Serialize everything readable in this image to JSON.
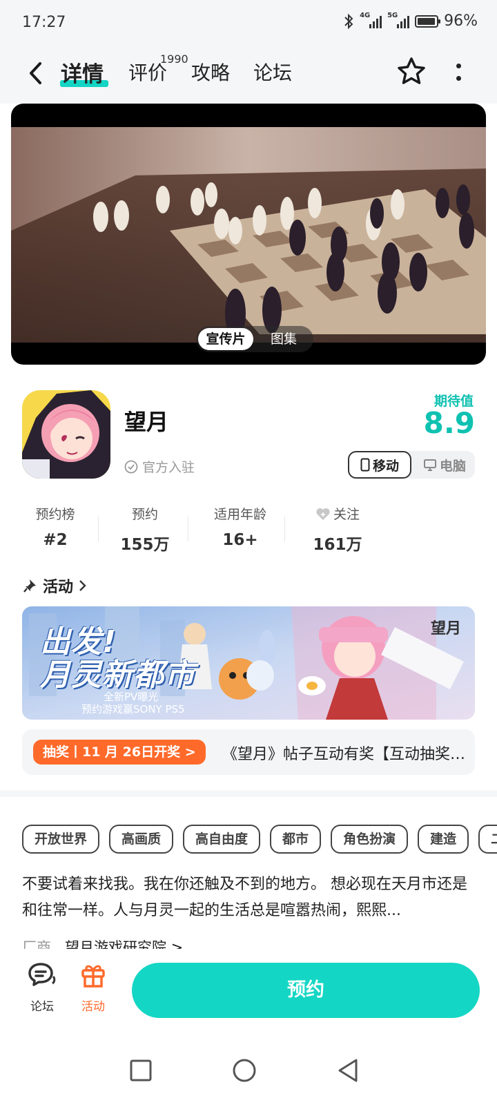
{
  "status_bar": {
    "time": "17:27",
    "net1": "4G",
    "net2": "5G",
    "battery": "96%",
    "icons": [
      "bluetooth-icon",
      "signal-icon",
      "battery-icon"
    ]
  },
  "nav": {
    "tabs": [
      {
        "label": "详情",
        "active": true
      },
      {
        "label": "评价",
        "badge": "1990"
      },
      {
        "label": "攻略"
      },
      {
        "label": "论坛"
      }
    ],
    "icons": [
      "back-icon",
      "star-icon",
      "more-icon"
    ]
  },
  "video": {
    "toggle": [
      "宣传片",
      "图集"
    ],
    "active": "宣传片"
  },
  "game": {
    "name": "望月",
    "official": "官方入驻",
    "expect_label": "期待值",
    "expect_value": "8.9",
    "platforms": [
      "移动",
      "电脑"
    ],
    "active_platform": "移动"
  },
  "stats": [
    {
      "label": "预约榜",
      "value": "#2"
    },
    {
      "label": "预约",
      "value": "155万"
    },
    {
      "label": "适用年龄",
      "value": "16+"
    },
    {
      "label": "关注",
      "value": "161万",
      "icon": "heart-plus-icon"
    }
  ],
  "activity": {
    "header": "活动",
    "banner": {
      "line1": "出发!",
      "line2": "月灵新都市",
      "sub1": "全新PV曝光",
      "sub2": "预约游戏赢SONY PS5",
      "logo": "望月"
    },
    "lottery_tag": "抽奖丨11 月 26日开奖 >",
    "lottery_text": "《望月》帖子互动有奖【互动抽奖】新角色PV..."
  },
  "tags": [
    "开放世界",
    "高画质",
    "高自由度",
    "都市",
    "角色扮演",
    "建造",
    "二次元"
  ],
  "description": "不要试着来找我。我在你还触及不到的地方。 想必现在天月市还是和往常一样。人与月灵一起的生活总是喧嚣热闹，熙熙...",
  "developer": {
    "label": "厂商",
    "name": "望月游戏研究院 >"
  },
  "action_bar": {
    "forum": "论坛",
    "activity": "活动",
    "reserve": "预约"
  },
  "colors": {
    "accent": "#14d6c4",
    "accent_text": "#0fc1b1",
    "orange": "#ff6a2b"
  }
}
